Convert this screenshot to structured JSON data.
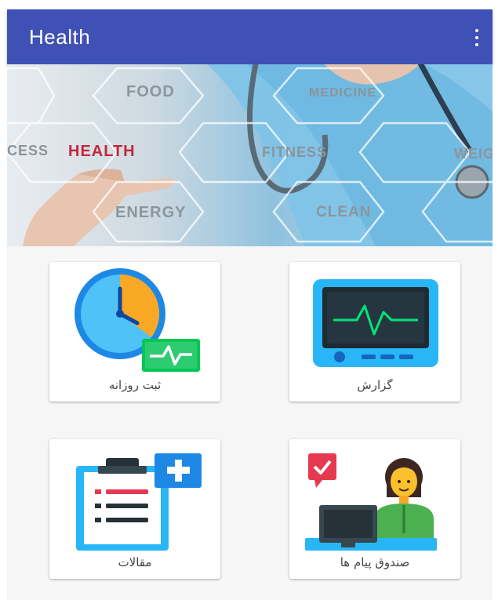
{
  "appbar": {
    "title": "Health",
    "menu_icon": "overflow-menu-icon"
  },
  "banner": {
    "words": {
      "food": "FOOD",
      "medicine": "MEDICINE",
      "success": "CESS",
      "health": "HEALTH",
      "fitness": "FITNESS",
      "weight": "WEIG",
      "energy": "ENERGY",
      "clean": "CLEAN"
    }
  },
  "cards": {
    "daily_log": {
      "label": "ثبت روزانه",
      "icon": "clock-heartbeat-icon"
    },
    "report": {
      "label": "گزارش",
      "icon": "heart-monitor-icon"
    },
    "articles": {
      "label": "مقالات",
      "icon": "clipboard-plus-icon"
    },
    "inbox": {
      "label": "صندوق پیام ها",
      "icon": "doctor-message-icon"
    }
  },
  "colors": {
    "appbar": "#3f51b5",
    "health_word": "#c0283c",
    "accent_green": "#2ecc71",
    "accent_blue": "#29b6f6",
    "accent_yellow": "#fbc02d",
    "accent_red": "#e53950"
  }
}
